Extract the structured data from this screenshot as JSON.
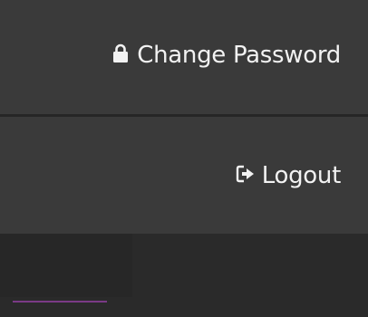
{
  "menu": {
    "change_password": {
      "label": "Change Password",
      "icon": "lock-icon"
    },
    "logout": {
      "label": "Logout",
      "icon": "sign-out-icon"
    }
  },
  "colors": {
    "menu_background": "#3a3a3a",
    "text": "#f2f2f2",
    "accent": "#7a3a86"
  }
}
